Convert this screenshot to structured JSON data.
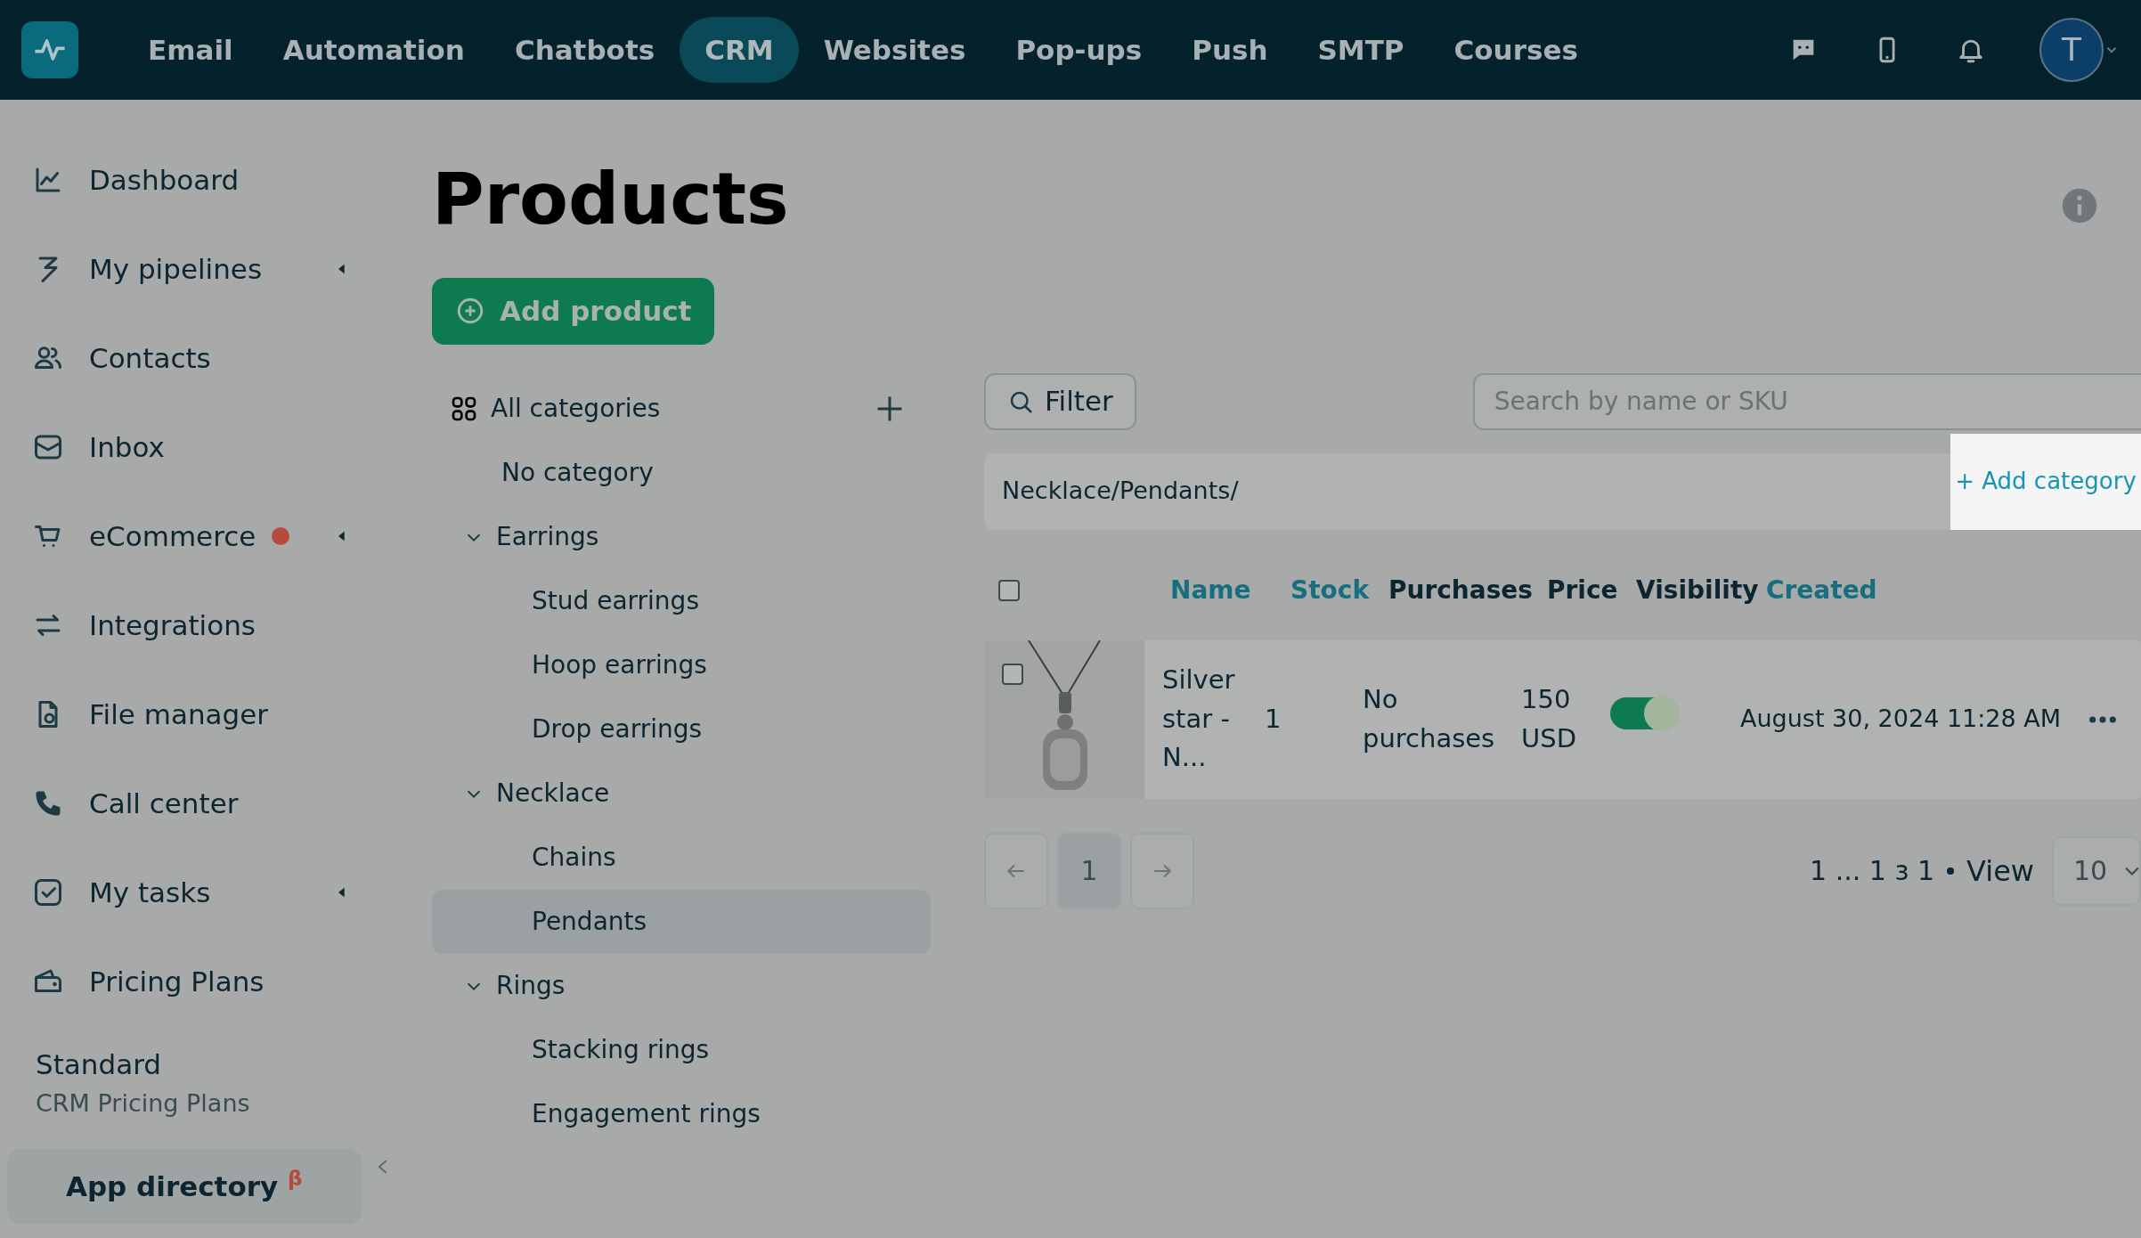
{
  "topnav": {
    "items": [
      {
        "label": "Email",
        "selected": false
      },
      {
        "label": "Automation",
        "selected": false
      },
      {
        "label": "Chatbots",
        "selected": false
      },
      {
        "label": "CRM",
        "selected": true
      },
      {
        "label": "Websites",
        "selected": false
      },
      {
        "label": "Pop-ups",
        "selected": false
      },
      {
        "label": "Push",
        "selected": false
      },
      {
        "label": "SMTP",
        "selected": false
      },
      {
        "label": "Courses",
        "selected": false
      }
    ],
    "avatar": "T"
  },
  "sidebar": {
    "items": [
      {
        "label": "Dashboard",
        "has_submenu": false,
        "badge": false
      },
      {
        "label": "My pipelines",
        "has_submenu": true,
        "badge": false
      },
      {
        "label": "Contacts",
        "has_submenu": false,
        "badge": false
      },
      {
        "label": "Inbox",
        "has_submenu": false,
        "badge": false
      },
      {
        "label": "eCommerce",
        "has_submenu": true,
        "badge": true
      },
      {
        "label": "Integrations",
        "has_submenu": false,
        "badge": false
      },
      {
        "label": "File manager",
        "has_submenu": false,
        "badge": false
      },
      {
        "label": "Call center",
        "has_submenu": false,
        "badge": false
      },
      {
        "label": "My tasks",
        "has_submenu": true,
        "badge": false
      },
      {
        "label": "Pricing Plans",
        "has_submenu": false,
        "badge": false
      }
    ],
    "plan": {
      "name": "Standard",
      "subtitle": "CRM Pricing Plans"
    },
    "app_directory": {
      "label": "App directory",
      "mark": "β"
    }
  },
  "page": {
    "title": "Products",
    "add_button": "Add product"
  },
  "categories": {
    "root": "All categories",
    "items": [
      {
        "label": "No category",
        "selected": false
      },
      {
        "label": "Earrings",
        "selected": false,
        "expanded": true,
        "children": [
          {
            "label": "Stud earrings",
            "selected": false
          },
          {
            "label": "Hoop earrings",
            "selected": false
          },
          {
            "label": "Drop earrings",
            "selected": false
          }
        ]
      },
      {
        "label": "Necklace",
        "selected": false,
        "expanded": true,
        "children": [
          {
            "label": "Chains",
            "selected": false
          },
          {
            "label": "Pendants",
            "selected": true
          }
        ]
      },
      {
        "label": "Rings",
        "selected": false,
        "expanded": true,
        "children": [
          {
            "label": "Stacking rings",
            "selected": false
          },
          {
            "label": "Engagement rings",
            "selected": false
          }
        ]
      }
    ]
  },
  "toolbar": {
    "filter": "Filter",
    "search_placeholder": "Search by name or SKU"
  },
  "breadcrumb": {
    "path": "Necklace/Pendants/",
    "action": "+ Add category"
  },
  "table": {
    "select_all_checked": false,
    "columns": [
      {
        "label": "Name",
        "sortable": true
      },
      {
        "label": "Stock",
        "sortable": true
      },
      {
        "label": "Purchases",
        "sortable": false
      },
      {
        "label": "Price",
        "sortable": false
      },
      {
        "label": "Visibility",
        "sortable": false
      },
      {
        "label": "Created",
        "sortable": true
      }
    ],
    "rows": [
      {
        "checked": false,
        "name": "Silver star - N...",
        "stock": "1",
        "purchases": "No purchases",
        "price": "150 USD",
        "visible": true,
        "created": "August 30, 2024 11:28 AM"
      }
    ]
  },
  "pagination": {
    "pages": [
      {
        "label": "1",
        "selected": true
      }
    ],
    "summary": "1 ... 1 з 1",
    "view_label": "View",
    "page_size": "10"
  }
}
